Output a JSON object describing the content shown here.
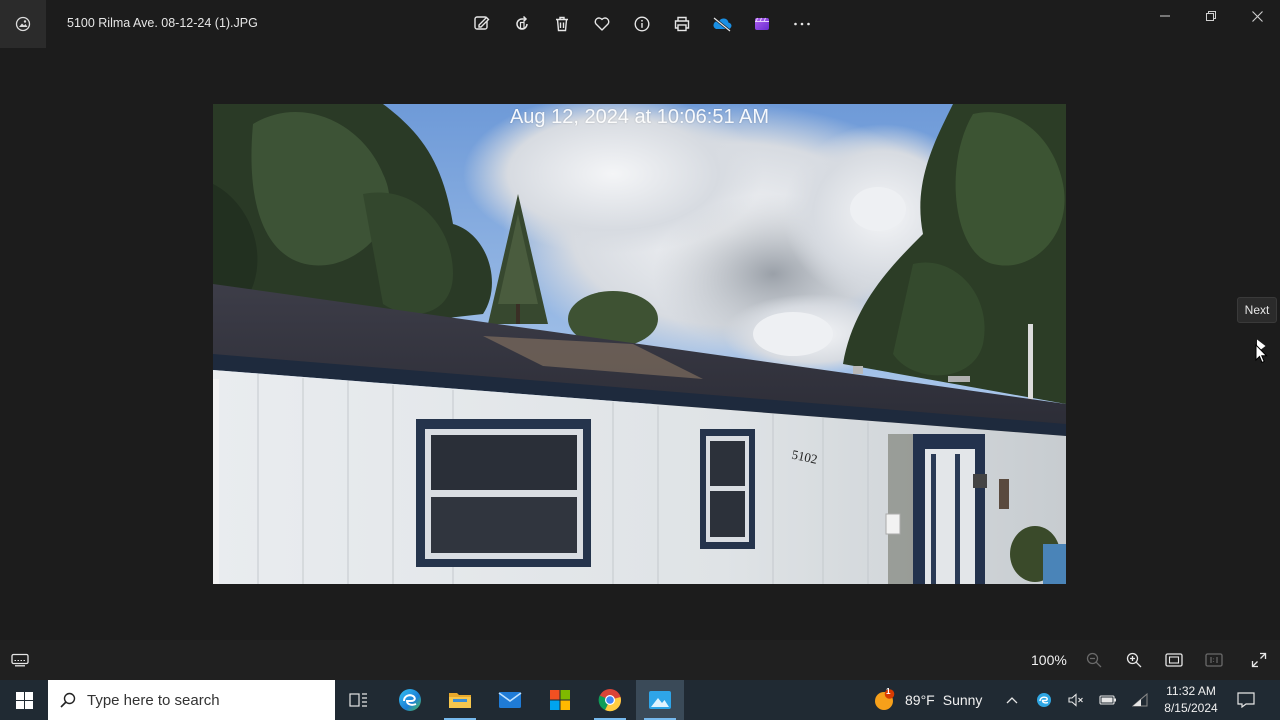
{
  "titlebar": {
    "file_name": "5100 Rilma Ave. 08-12-24 (1).JPG",
    "toolbar": [
      "edit-image-icon",
      "rotate-icon",
      "delete-icon",
      "favorite-icon",
      "info-icon",
      "print-icon",
      "onedrive-icon",
      "clipchamp-icon",
      "more-icon"
    ],
    "window_controls": [
      "minimize-icon",
      "restore-icon",
      "close-icon"
    ]
  },
  "photo": {
    "timestamp": "Aug 12, 2024 at 10:06:51 AM",
    "house_number": "5102"
  },
  "navigation": {
    "next_tooltip": "Next"
  },
  "bottombar": {
    "zoom": "100%"
  },
  "taskbar": {
    "search_placeholder": "Type here to search",
    "apps": [
      "task-view-icon",
      "edge-icon",
      "file-explorer-icon",
      "mail-icon",
      "microsoft-store-icon",
      "chrome-icon",
      "photos-icon"
    ],
    "weather": {
      "badge": "1",
      "temp": "89°F",
      "condition": "Sunny"
    },
    "clock": {
      "time": "11:32 AM",
      "date": "8/15/2024"
    }
  },
  "colors": {
    "app_background": "#1c1c1c",
    "taskbar": "#202a33",
    "accent": "#76b9ed"
  }
}
